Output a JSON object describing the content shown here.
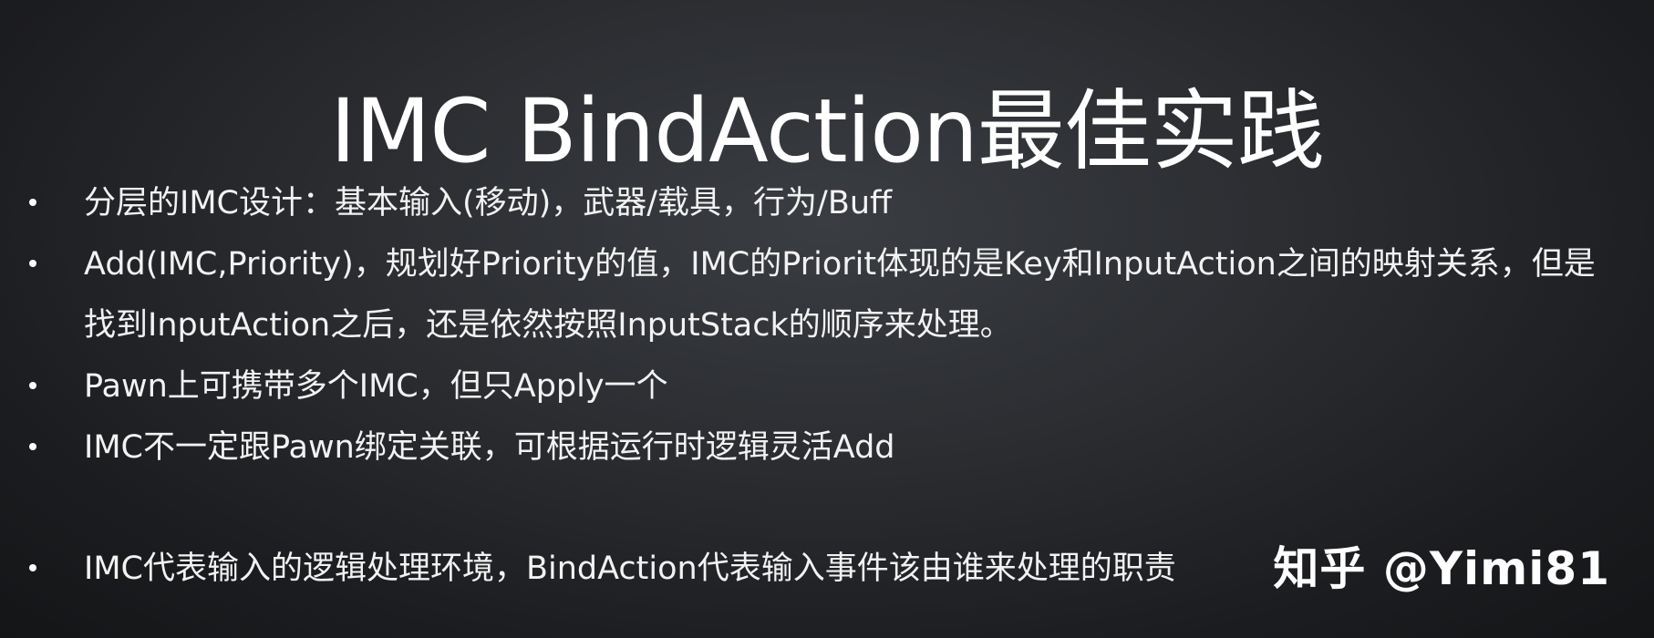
{
  "slide": {
    "title": "IMC BindAction最佳实践",
    "bullets": [
      "分层的IMC设计：基本输入(移动)，武器/载具，行为/Buff",
      "Add(IMC,Priority)，规划好Priority的值，IMC的Priorit体现的是Key和InputAction之间的映射关系，但是找到InputAction之后，还是依然按照InputStack的顺序来处理。",
      "Pawn上可携带多个IMC，但只Apply一个",
      "IMC不一定跟Pawn绑定关联，可根据运行时逻辑灵活Add",
      "IMC代表输入的逻辑处理环境，BindAction代表输入事件该由谁来处理的职责"
    ],
    "watermark": "知乎 @Yimi81"
  }
}
